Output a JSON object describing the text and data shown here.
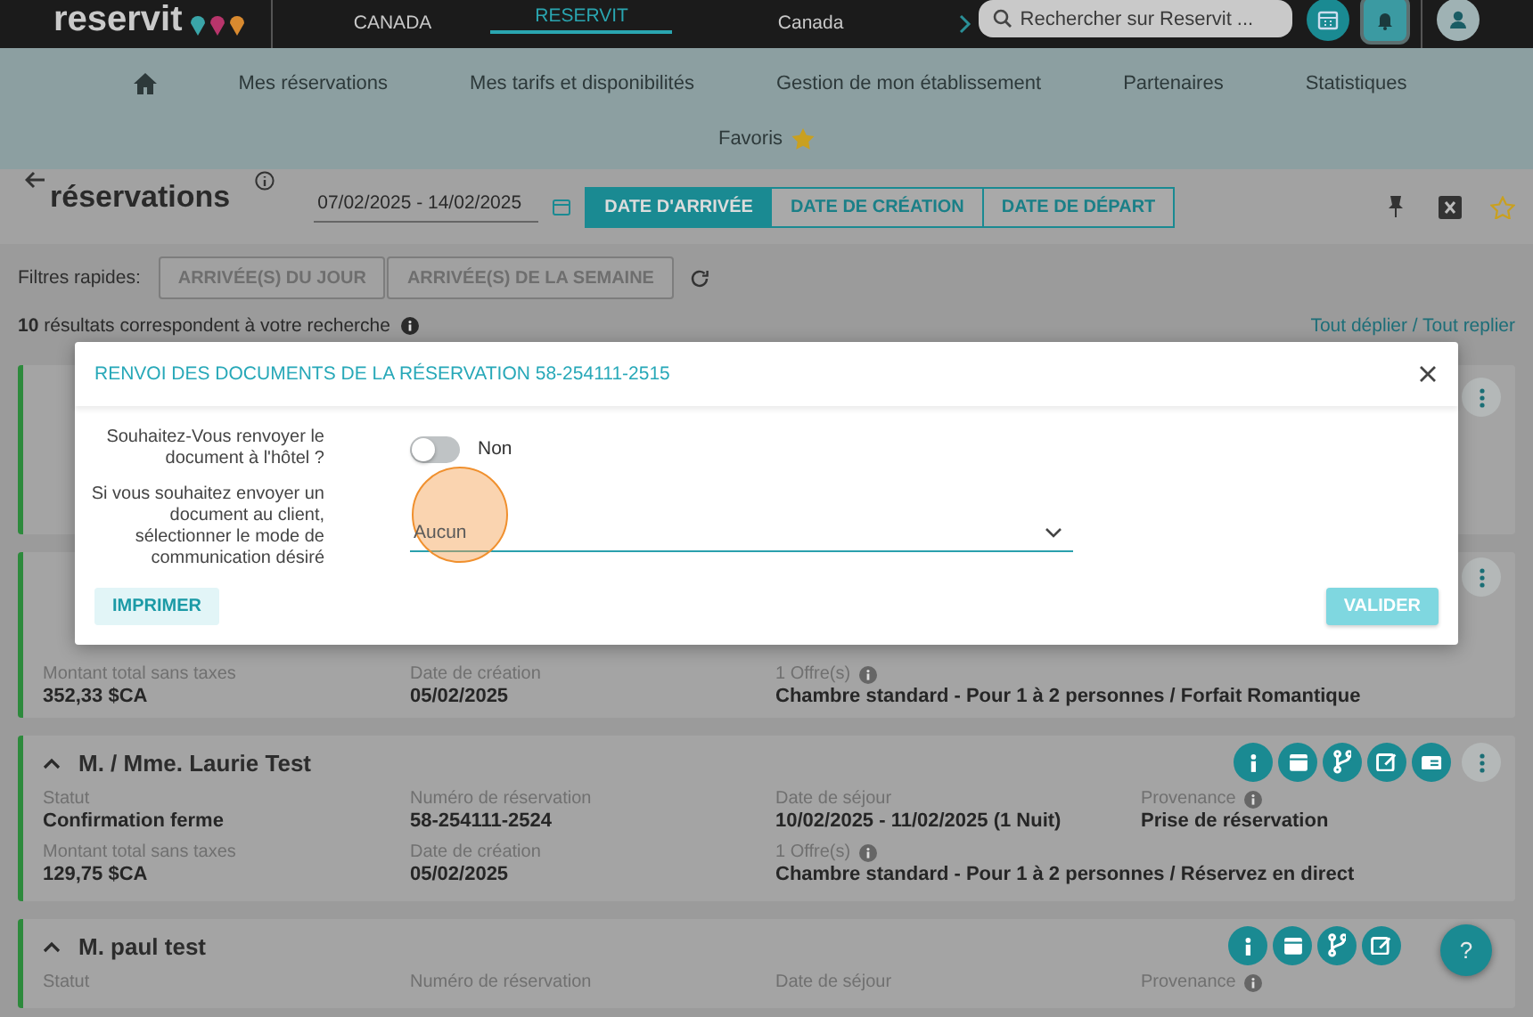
{
  "top_bar": {
    "logo": "reservit",
    "tabs": [
      {
        "label": "CANADA",
        "selected": false
      },
      {
        "label": "RESERVIT",
        "selected": true
      },
      {
        "label": "Canada",
        "selected": false
      }
    ],
    "search": {
      "placeholder": "Rechercher sur Reservit ..."
    },
    "icon_buttons": [
      {
        "kind": "calendar",
        "selected": false
      },
      {
        "kind": "bell",
        "selected": true
      },
      {
        "kind": "user",
        "selected": false
      }
    ]
  },
  "nav": {
    "items": [
      "Mes réservations",
      "Mes tarifs et disponibilités",
      "Gestion de mon établissement",
      "Partenaires",
      "Statistiques"
    ],
    "favorites": "Favoris"
  },
  "page_header": {
    "title": "réservations",
    "date_range": "07/02/2025 - 14/02/2025",
    "date_types": [
      {
        "label": "DATE D'ARRIVÉE",
        "selected": true
      },
      {
        "label": "DATE DE CRÉATION",
        "selected": false
      },
      {
        "label": "DATE DE DÉPART",
        "selected": false
      }
    ]
  },
  "quick_filters": {
    "label": "Filtres rapides:",
    "buttons": [
      "ARRIVÉE(S) DU JOUR",
      "ARRIVÉE(S) DE LA SEMAINE"
    ]
  },
  "results": {
    "summary": "**10** résultats correspondent à votre recherche",
    "toggle_link": "Tout déplier / Tout replier"
  },
  "reservations": [
    {
      "kind": "covered"
    },
    {
      "kind": "partly_covered",
      "rows": [
        [
          {
            "label": "Montant total sans taxes",
            "value": "352,33 $CA",
            "info": false
          },
          {
            "label": "Date de création",
            "value": "05/02/2025",
            "info": false
          },
          {
            "label": "1 Offre(s)",
            "value": "Chambre standard - Pour 1 à 2 personnes / Forfait Romantique",
            "info": true
          }
        ]
      ]
    },
    {
      "kind": "full",
      "name": "M. / Mme. Laurie Test",
      "rows": [
        [
          {
            "label": "Statut",
            "value": "Confirmation ferme",
            "info": false
          },
          {
            "label": "Numéro de réservation",
            "value": "58-254111-2524",
            "info": false
          },
          {
            "label": "Date de séjour",
            "value": "10/02/2025 - 11/02/2025 (1 Nuit)",
            "info": false
          },
          {
            "label": "Provenance",
            "value": "Prise de réservation",
            "info": true
          }
        ],
        [
          {
            "label": "Montant total sans taxes",
            "value": "129,75 $CA",
            "info": false
          },
          {
            "label": "Date de création",
            "value": "05/02/2025",
            "info": false
          },
          {
            "label": "1 Offre(s)",
            "value": "Chambre standard - Pour 1 à 2 personnes / Réservez en direct",
            "info": true
          }
        ]
      ]
    },
    {
      "kind": "cut",
      "name": "M. paul test",
      "rows": [
        [
          {
            "label": "Statut",
            "info": false
          },
          {
            "label": "Numéro de réservation",
            "info": false
          },
          {
            "label": "Date de séjour",
            "info": false
          },
          {
            "label": "Provenance",
            "info": true
          }
        ]
      ]
    }
  ],
  "help_button": "?",
  "modal": {
    "title": "RENVOI DES DOCUMENTS DE LA RÉSERVATION 58-254111-2515",
    "hotel_question": "Souhaitez-Vous renvoyer le document à l'hôtel ?",
    "hotel_toggle": {
      "on": false,
      "label": "Non"
    },
    "client_question": "Si vous souhaitez envoyer un document au client, sélectionner le mode de communication désiré",
    "communication_select": {
      "placeholder": "Aucun"
    },
    "buttons": [
      {
        "label": "IMPRIMER",
        "kind": "secondary",
        "disabled": false
      },
      {
        "label": "VALIDER",
        "kind": "primary",
        "disabled": true
      }
    ]
  }
}
